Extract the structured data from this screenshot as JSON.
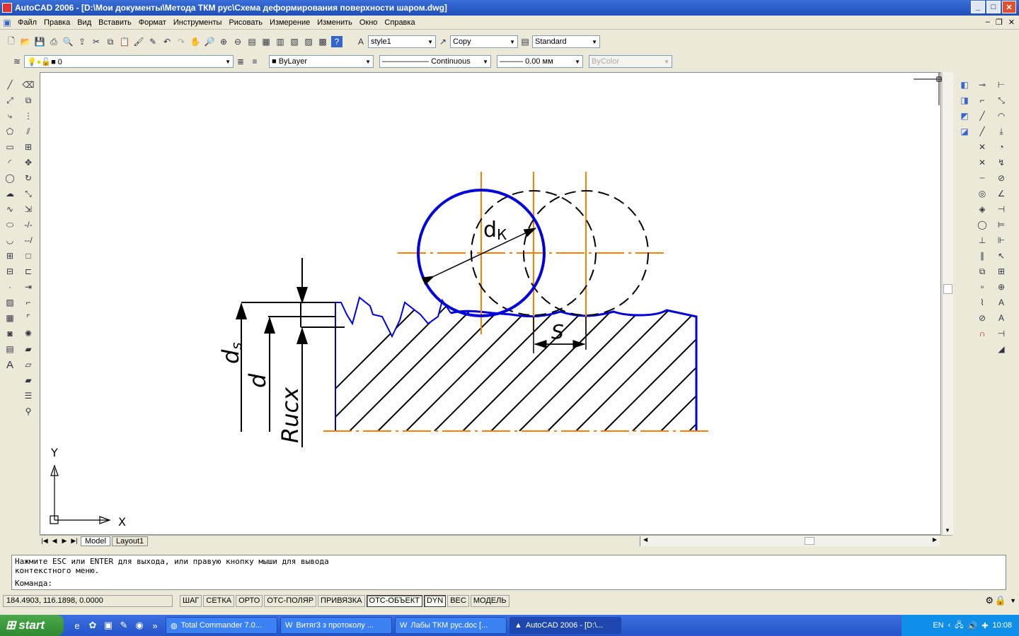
{
  "window": {
    "title": "AutoCAD 2006 - [D:\\Мои документы\\Метода ТКМ рус\\Схема деформирования поверхности шаром.dwg]"
  },
  "menu": [
    "Файл",
    "Правка",
    "Вид",
    "Вставить",
    "Формат",
    "Инструменты",
    "Рисовать",
    "Измерение",
    "Изменить",
    "Окно",
    "Справка"
  ],
  "toolbar_standard": {
    "text_style": "style1",
    "dim_style": "Copy",
    "table_style": "Standard"
  },
  "toolbar_layers": {
    "layer": "0",
    "color": "ByLayer",
    "linetype": "Continuous",
    "lineweight": "0.00 мм",
    "plotstyle": "ByColor"
  },
  "drawing": {
    "label_dk_main": "d",
    "label_dk_sub": "К",
    "label_s": "S",
    "label_ds_main": "d",
    "label_ds_sub": "s",
    "label_d": "d",
    "label_rucx": "Rucx",
    "ucs_x": "X",
    "ucs_y": "Y",
    "colors": {
      "ball": "#0000dd",
      "axis": "#ff8000",
      "ink": "#000000"
    }
  },
  "tabs": [
    "Model",
    "Layout1"
  ],
  "command": {
    "line1": "Нажмите ESC или ENTER для выхода, или правую кнопку мыши для вывода",
    "line2": "контекстного меню.",
    "prompt": "Команда:"
  },
  "status": {
    "coords": "184.4903, 116.1898, 0.0000",
    "buttons": [
      {
        "label": "ШАГ",
        "on": false
      },
      {
        "label": "СЕТКА",
        "on": false
      },
      {
        "label": "ОРТО",
        "on": false
      },
      {
        "label": "ОТС-ПОЛЯР",
        "on": false
      },
      {
        "label": "ПРИВЯЗКА",
        "on": false
      },
      {
        "label": "ОТС-ОБЪЕКТ",
        "on": true
      },
      {
        "label": "DYN",
        "on": true
      },
      {
        "label": "ВЕС",
        "on": false
      },
      {
        "label": "МОДЕЛЬ",
        "on": false
      }
    ]
  },
  "taskbar": {
    "start": "start",
    "tasks": [
      "Total Commander 7.0...",
      "Витяг3 з протоколу ...",
      "Лабы ТКМ рус.doc [...",
      "AutoCAD 2006 - [D:\\..."
    ],
    "lang": "EN",
    "clock": "10:08"
  }
}
